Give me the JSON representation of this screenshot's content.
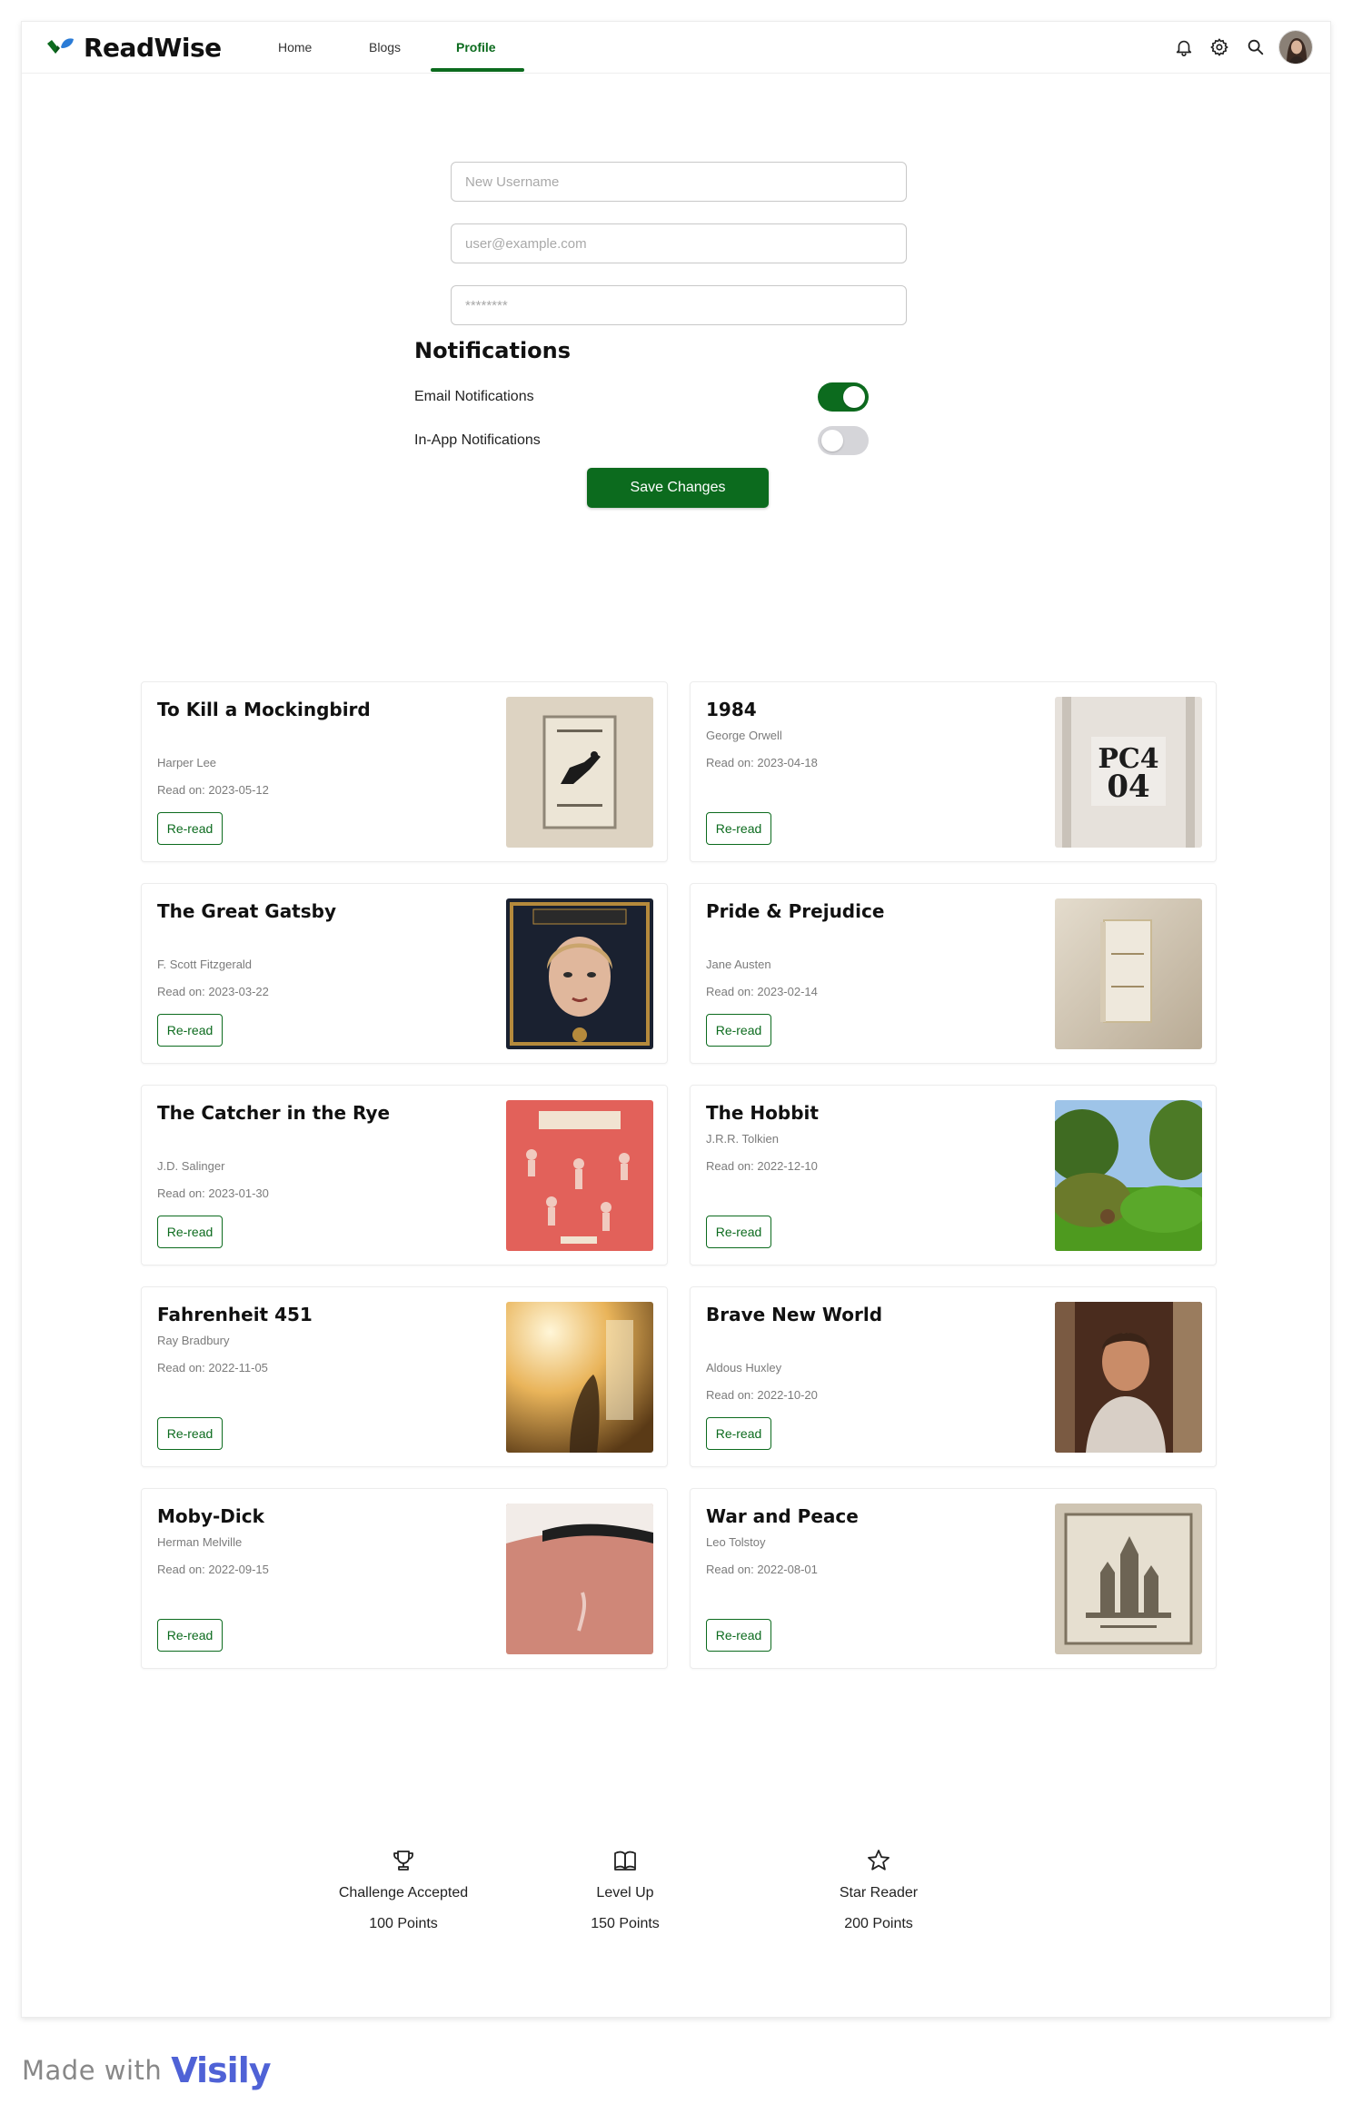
{
  "nav": {
    "brand": "ReadWise",
    "links": [
      {
        "label": "Home"
      },
      {
        "label": "Blogs"
      },
      {
        "label": "Profile"
      }
    ],
    "icons": [
      "bell-icon",
      "gear-icon",
      "search-icon"
    ],
    "accent_color": "#0c6b1e"
  },
  "form": {
    "username_placeholder": "New Username",
    "email_placeholder": "user@example.com",
    "password_placeholder": "********"
  },
  "notifications": {
    "title": "Notifications",
    "email_label": "Email Notifications",
    "email_enabled": true,
    "inapp_label": "In-App Notifications",
    "inapp_enabled": false,
    "save_label": "Save Changes"
  },
  "books": [
    {
      "title": "To Kill a Mockingbird",
      "author": "Harper Lee",
      "read_on": "Read on: 2023-05-12",
      "button": "Re-read"
    },
    {
      "title": "1984",
      "author": "George Orwell",
      "read_on": "Read on: 2023-04-18",
      "button": "Re-read"
    },
    {
      "title": "The Great Gatsby",
      "author": "F. Scott Fitzgerald",
      "read_on": "Read on: 2023-03-22",
      "button": "Re-read"
    },
    {
      "title": "Pride & Prejudice",
      "author": "Jane Austen",
      "read_on": "Read on: 2023-02-14",
      "button": "Re-read"
    },
    {
      "title": "The Catcher in the Rye",
      "author": "J.D. Salinger",
      "read_on": "Read on: 2023-01-30",
      "button": "Re-read"
    },
    {
      "title": "The Hobbit",
      "author": "J.R.R. Tolkien",
      "read_on": "Read on: 2022-12-10",
      "button": "Re-read"
    },
    {
      "title": "Fahrenheit 451",
      "author": "Ray Bradbury",
      "read_on": "Read on: 2022-11-05",
      "button": "Re-read"
    },
    {
      "title": "Brave New World",
      "author": "Aldous Huxley",
      "read_on": "Read on: 2022-10-20",
      "button": "Re-read"
    },
    {
      "title": "Moby-Dick",
      "author": "Herman Melville",
      "read_on": "Read on: 2022-09-15",
      "button": "Re-read"
    },
    {
      "title": "War and Peace",
      "author": "Leo Tolstoy",
      "read_on": "Read on: 2022-08-01",
      "button": "Re-read"
    }
  ],
  "achievements": [
    {
      "icon": "trophy-icon",
      "name": "Challenge Accepted",
      "points": "100 Points"
    },
    {
      "icon": "book-icon",
      "name": "Level Up",
      "points": "150 Points"
    },
    {
      "icon": "star-icon",
      "name": "Star Reader",
      "points": "200 Points"
    }
  ],
  "footer": {
    "made_with": "Made with",
    "brand": "Visily"
  }
}
